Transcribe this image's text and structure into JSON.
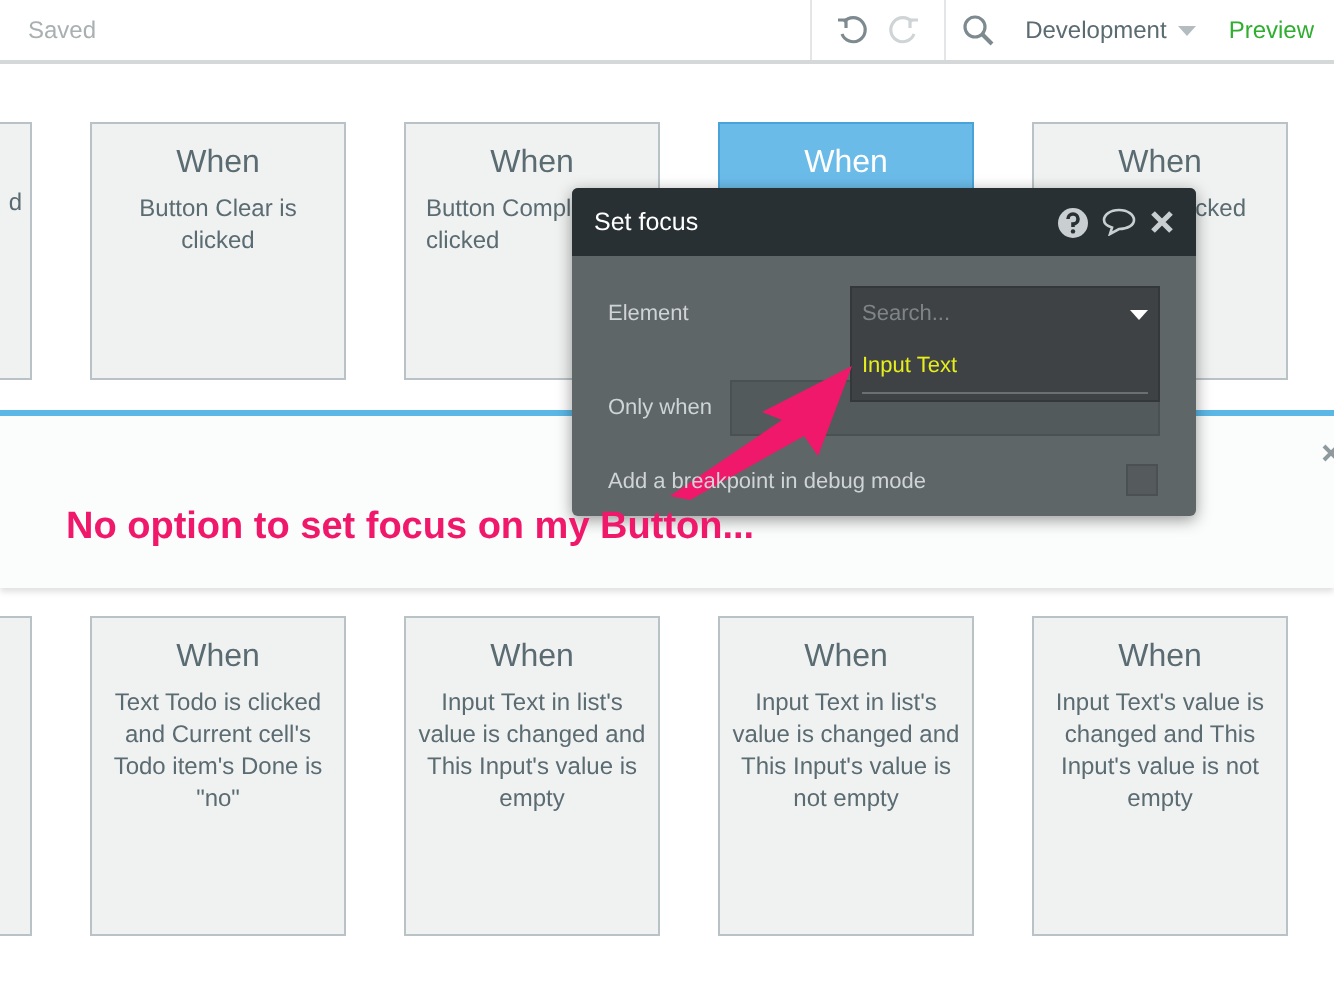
{
  "toolbar": {
    "status": "Saved",
    "environment": "Development",
    "preview": "Preview"
  },
  "top_cards": [
    {
      "kind": "right_part",
      "text": "d",
      "selected": false
    },
    {
      "kind": "full",
      "title": "When",
      "text": "Button Clear is clicked",
      "selected": false
    },
    {
      "kind": "left_part",
      "title": "When",
      "text": "Button Compl\nclicked",
      "selected": false
    },
    {
      "kind": "full",
      "title": "When",
      "selected": true
    },
    {
      "kind": "right_part",
      "title": "When",
      "text": "cked",
      "selected": false
    }
  ],
  "bottom_cards": [
    {
      "kind": "right_part",
      "selected": false
    },
    {
      "kind": "full",
      "title": "When",
      "text": "Text Todo is clicked and Current cell's Todo item's Done is \"no\"",
      "selected": false
    },
    {
      "kind": "full",
      "title": "When",
      "text": "Input Text in list's value is changed and This Input's value is empty",
      "selected": false
    },
    {
      "kind": "full",
      "title": "When",
      "text": "Input Text in list's value is changed and This Input's value is not empty",
      "selected": false
    },
    {
      "kind": "full",
      "title": "When",
      "text": "Input Text's value is changed and This Input's value is not empty",
      "selected": false
    }
  ],
  "dialog": {
    "title": "Set focus",
    "element_label": "Element",
    "search_placeholder": "Search...",
    "options": [
      "Input Text"
    ],
    "only_when_label": "Only when",
    "breakpoint_label": "Add a breakpoint in debug mode",
    "breakpoint_checked": false
  },
  "annotation": "No option to set focus on my Button..."
}
